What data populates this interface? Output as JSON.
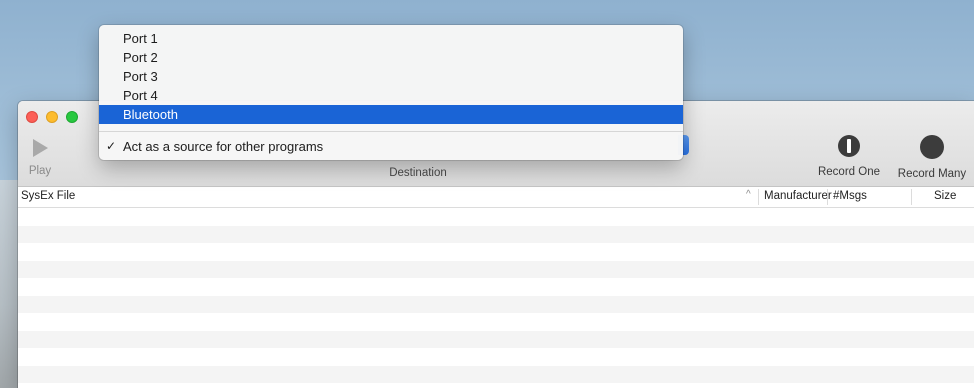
{
  "toolbar": {
    "play_label": "Play",
    "destination_label": "Destination",
    "record_one_label": "Record One",
    "record_many_label": "Record Many"
  },
  "table": {
    "columns": {
      "file": "SysEx File",
      "sort_indicator": "^",
      "manufacturer": "Manufacturer",
      "msgs": "#Msgs",
      "size": "Size"
    },
    "rows": []
  },
  "destination_menu": {
    "items": [
      {
        "label": "Port 1",
        "checked": false,
        "highlighted": false
      },
      {
        "label": "Port 2",
        "checked": false,
        "highlighted": false
      },
      {
        "label": "Port 3",
        "checked": false,
        "highlighted": false
      },
      {
        "label": "Port 4",
        "checked": false,
        "highlighted": false
      },
      {
        "label": "Bluetooth",
        "checked": false,
        "highlighted": true
      }
    ],
    "option": {
      "label": "Act as a source for other programs",
      "checked": true,
      "check_glyph": "✓"
    }
  },
  "colors": {
    "highlight": "#1a64d6",
    "close": "#fc5f57",
    "minimize": "#fdbc2e",
    "maximize": "#28c840",
    "record": "#3c3c3c"
  }
}
